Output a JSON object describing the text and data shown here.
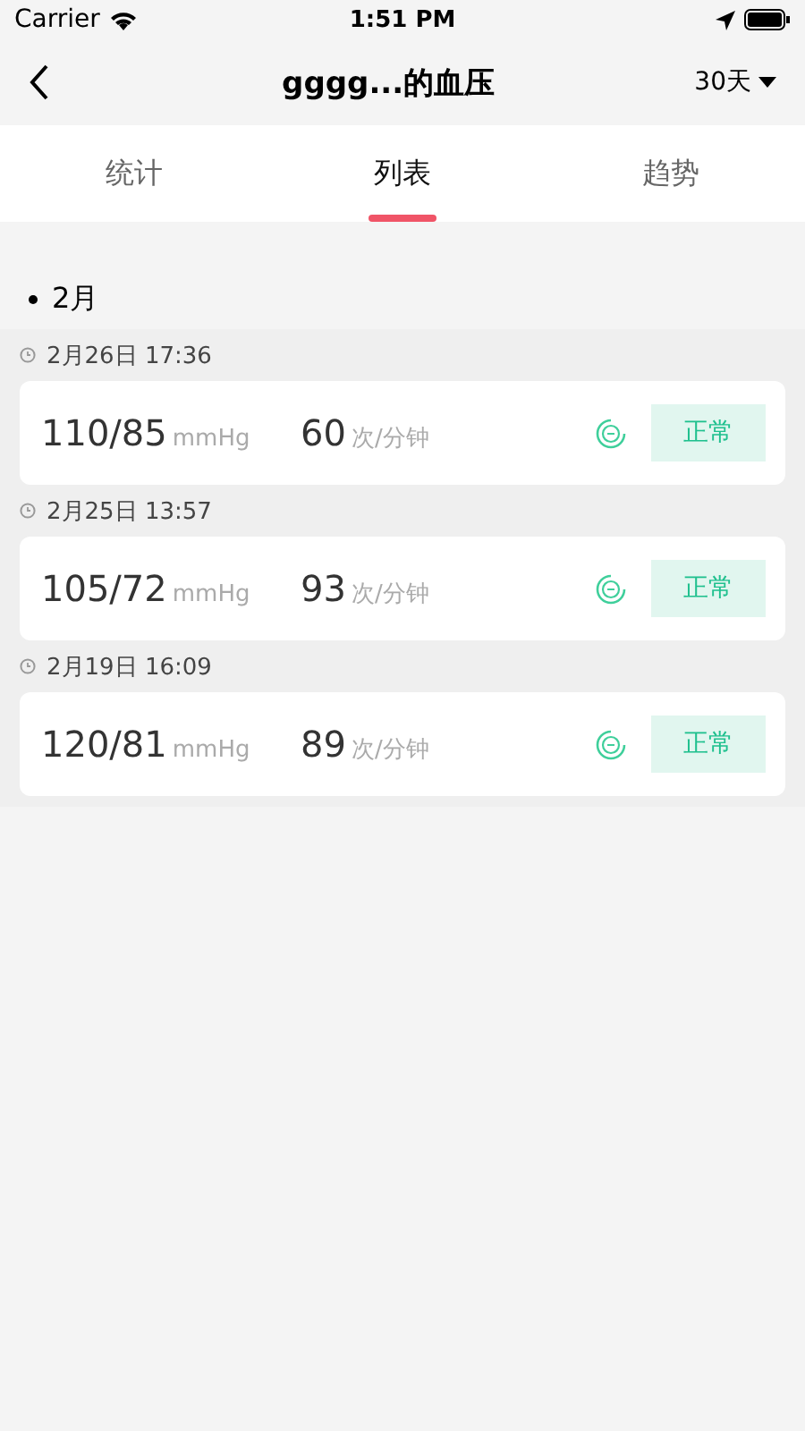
{
  "status_bar": {
    "carrier": "Carrier",
    "time": "1:51 PM"
  },
  "nav": {
    "title": "gggg...的血压",
    "range": "30天"
  },
  "tabs": [
    {
      "label": "统计",
      "selected": false
    },
    {
      "label": "列表",
      "selected": true
    },
    {
      "label": "趋势",
      "selected": false
    }
  ],
  "section": {
    "title": "2月"
  },
  "records": [
    {
      "time": "2月26日 17:36",
      "pressure": "110/85",
      "pressure_unit": "mmHg",
      "pulse": "60",
      "pulse_unit": "次/分钟",
      "status": "正常"
    },
    {
      "time": "2月25日 13:57",
      "pressure": "105/72",
      "pressure_unit": "mmHg",
      "pulse": "93",
      "pulse_unit": "次/分钟",
      "status": "正常"
    },
    {
      "time": "2月19日 16:09",
      "pressure": "120/81",
      "pressure_unit": "mmHg",
      "pulse": "89",
      "pulse_unit": "次/分钟",
      "status": "正常"
    }
  ]
}
